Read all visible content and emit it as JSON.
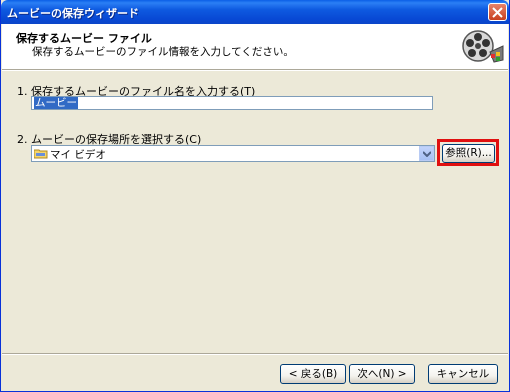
{
  "window": {
    "title": "ムービーの保存ウィザード",
    "close_icon": "close-icon"
  },
  "header": {
    "title": "保存するムービー ファイル",
    "subtitle": "保存するムービーのファイル情報を入力してください。",
    "icon": "film-reel-icon"
  },
  "step1": {
    "label": "1. 保存するムービーのファイル名を入力する(T)",
    "filename_value": "ムービー"
  },
  "step2": {
    "label": "2. ムービーの保存場所を選択する(C)",
    "location_value": "マイ ビデオ",
    "browse_label": "参照(R)..."
  },
  "buttons": {
    "back": "< 戻る(B)",
    "next": "次へ(N) >",
    "cancel": "キャンセル"
  },
  "colors": {
    "highlight": "#e01010",
    "titlebar": "#0a5fe6",
    "selection": "#316ac5"
  }
}
